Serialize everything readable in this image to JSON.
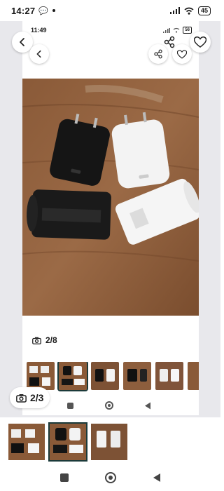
{
  "outer_status": {
    "time": "14:27",
    "battery": "45"
  },
  "inner_status": {
    "time": "11:49",
    "battery": "56"
  },
  "viewer": {
    "inner_counter": "2/8",
    "outer_counter": "2/3"
  },
  "icons": {
    "back": "chevron-left-icon",
    "share": "share-icon",
    "favorite": "heart-icon",
    "camera": "camera-icon",
    "recent": "square-icon",
    "home": "circle-icon",
    "nav_back": "triangle-back-icon"
  },
  "colors": {
    "backdrop": "#e8e8ec",
    "selected_border": "#1b3a3a"
  }
}
